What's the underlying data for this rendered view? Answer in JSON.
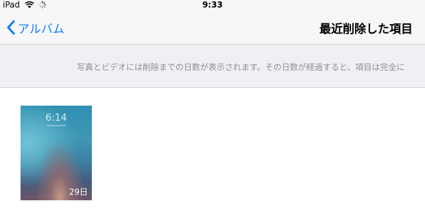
{
  "status_bar": {
    "carrier": "iPad",
    "time": "9:33"
  },
  "nav": {
    "back_label": "アルバム",
    "title": "最近削除した項目"
  },
  "banner": {
    "text": "写真とビデオには削除までの日数が表示されます。その日数が経過すると、項目は完全に"
  },
  "photos": [
    {
      "lock_time": "6:14",
      "days_remaining": "29日"
    }
  ],
  "colors": {
    "accent": "#0a7aff",
    "banner_bg": "#efeff4",
    "banner_text": "#8e8e93"
  }
}
